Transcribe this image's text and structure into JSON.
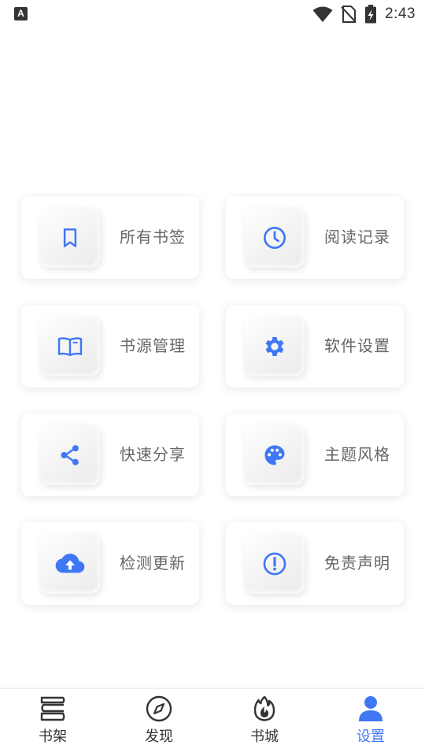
{
  "status_bar": {
    "notification_icon": "a-icon",
    "time": "2:43"
  },
  "colors": {
    "accent": "#3f77f5",
    "label_text": "#666666",
    "nav_text": "#333333"
  },
  "cards": [
    {
      "label": "所有书签",
      "icon": "bookmark-icon"
    },
    {
      "label": "阅读记录",
      "icon": "clock-icon"
    },
    {
      "label": "书源管理",
      "icon": "book-open-icon"
    },
    {
      "label": "软件设置",
      "icon": "gear-icon"
    },
    {
      "label": "快速分享",
      "icon": "share-icon"
    },
    {
      "label": "主题风格",
      "icon": "palette-icon"
    },
    {
      "label": "检测更新",
      "icon": "cloud-upload-icon"
    },
    {
      "label": "免责声明",
      "icon": "alert-circle-icon"
    }
  ],
  "nav": {
    "items": [
      {
        "label": "书架",
        "icon": "bookshelf-icon"
      },
      {
        "label": "发现",
        "icon": "compass-icon"
      },
      {
        "label": "书城",
        "icon": "flame-icon"
      },
      {
        "label": "设置",
        "icon": "person-icon"
      }
    ],
    "active": "设置"
  }
}
